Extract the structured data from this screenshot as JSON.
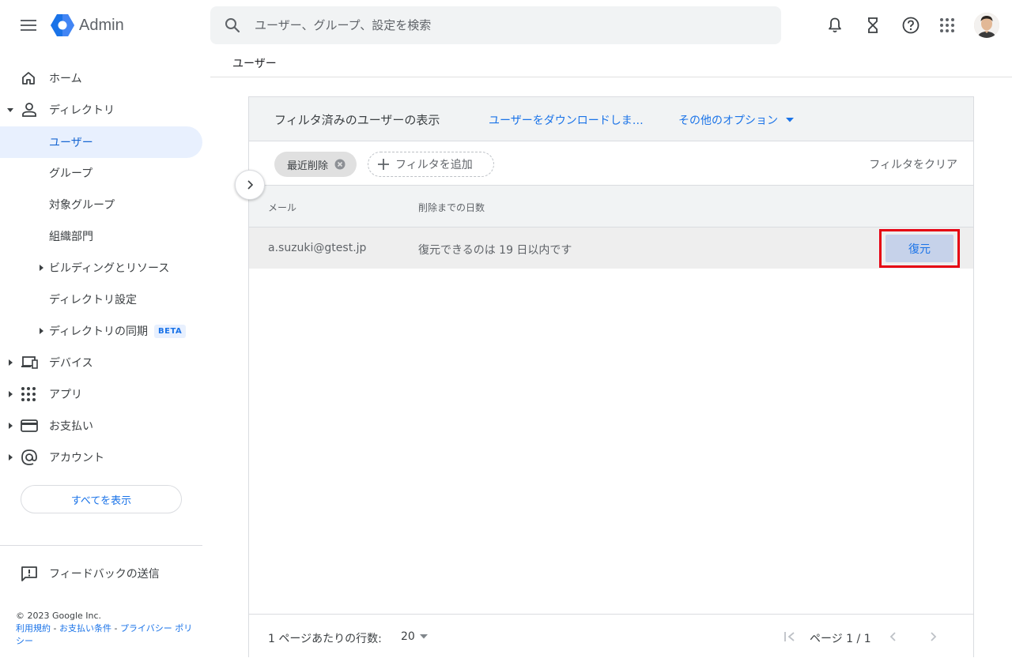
{
  "app": {
    "name": "Admin"
  },
  "search": {
    "placeholder": "ユーザー、グループ、設定を検索"
  },
  "header": {
    "icons": [
      "bell-icon",
      "hourglass-icon",
      "help-icon",
      "apps-grid-icon"
    ]
  },
  "sidebar": {
    "items": [
      {
        "label": "ホーム",
        "icon": "home-icon"
      },
      {
        "label": "ディレクトリ",
        "icon": "person-icon",
        "expanded": true
      },
      {
        "label": "ユーザー",
        "active": true
      },
      {
        "label": "グループ"
      },
      {
        "label": "対象グループ"
      },
      {
        "label": "組織部門"
      },
      {
        "label": "ビルディングとリソース",
        "collapsible": true
      },
      {
        "label": "ディレクトリ設定"
      },
      {
        "label": "ディレクトリの同期",
        "collapsible": true,
        "badge": "BETA"
      },
      {
        "label": "デバイス",
        "icon": "devices-icon"
      },
      {
        "label": "アプリ",
        "icon": "apps-icon"
      },
      {
        "label": "お支払い",
        "icon": "credit-card-icon"
      },
      {
        "label": "アカウント",
        "icon": "at-icon"
      }
    ],
    "show_all": "すべてを表示",
    "feedback": "フィードバックの送信",
    "footer": {
      "copyright": "© 2023 Google Inc.",
      "terms": "利用規約",
      "billing_terms": "お支払い条件",
      "privacy": "プライバシー ポリシー",
      "separator": " - "
    }
  },
  "breadcrumb": "ユーザー",
  "panel": {
    "title": "フィルタ済みのユーザーの表示",
    "download_link": "ユーザーをダウンロードしま…",
    "more_options": "その他のオプション",
    "filter_chip": "最近削除",
    "add_filter": "フィルタを追加",
    "clear_filter": "フィルタをクリア",
    "columns": [
      "メール",
      "削除までの日数"
    ],
    "rows": [
      {
        "email": "a.suzuki@gtest.jp",
        "days": "復元できるのは 19 日以内です",
        "action": "復元"
      }
    ],
    "footer": {
      "rows_per_page_label": "1 ページあたりの行数:",
      "rows_per_page": "20",
      "page_label": "ページ 1 / 1"
    }
  },
  "colors": {
    "accent": "#1a73e8",
    "highlight": "#e60012",
    "active_bg": "#e8f0fe"
  }
}
